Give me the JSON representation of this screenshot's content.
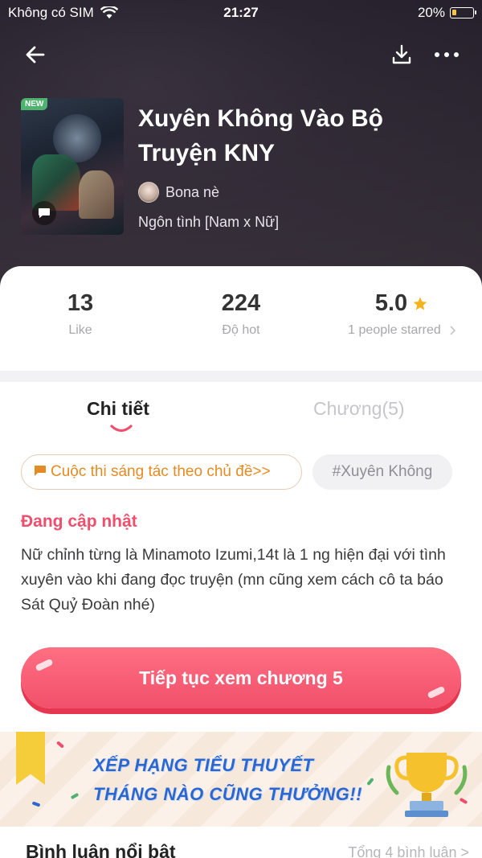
{
  "status_bar": {
    "carrier": "Không có SIM",
    "time": "21:27",
    "battery": "20%"
  },
  "book": {
    "badge": "NEW",
    "title": "Xuyên Không Vào Bộ Truyện KNY",
    "author": "Bona nè",
    "genre": "Ngôn tình [Nam x Nữ]"
  },
  "stats": {
    "like_value": "13",
    "like_label": "Like",
    "hot_value": "224",
    "hot_label": "Độ hot",
    "rating_value": "5.0",
    "rating_label": "1 people starred"
  },
  "tabs": {
    "detail": "Chi tiết",
    "chapters": "Chương(5)"
  },
  "chips": {
    "contest": "Cuộc thi sáng tác theo chủ đề>>",
    "tag": "#Xuyên Không"
  },
  "detail": {
    "status": "Đang cập nhật",
    "description": "Nữ chỉnh từng là Minamoto Izumi,14t là 1 ng hiện đại với tình xuyên vào khi đang đọc truyện (mn cũng xem cách cô ta báo Sát Quỷ Đoàn nhé)"
  },
  "cta": {
    "label": "Tiếp tục xem chương 5"
  },
  "banner": {
    "line1": "XẾP HẠNG TIỂU THUYẾT",
    "line2": "THÁNG NÀO CŨNG THƯỞNG!!"
  },
  "comments": {
    "title": "Bình luận nổi bật",
    "count": "Tổng 4 bình luận >"
  },
  "colors": {
    "accent_pink": "#f1506b",
    "contest_orange": "#e48b24",
    "star_gold": "#f5b21b",
    "banner_blue": "#2a67d1"
  }
}
